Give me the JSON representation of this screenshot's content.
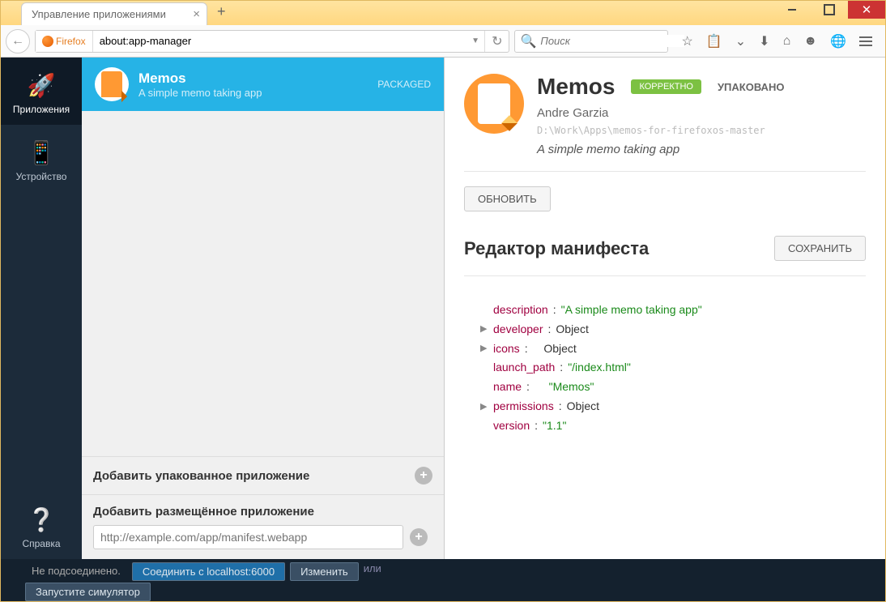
{
  "tab": {
    "title": "Управление приложениями"
  },
  "url": {
    "protocol": "Firefox",
    "value": "about:app-manager"
  },
  "search": {
    "placeholder": "Поиск"
  },
  "nav": {
    "apps": "Приложения",
    "device": "Устройство",
    "help": "Справка"
  },
  "list": {
    "app": {
      "name": "Memos",
      "desc": "A simple memo taking app",
      "type": "PACKAGED"
    },
    "add_packaged": "Добавить упакованное приложение",
    "add_hosted": "Добавить размещённое приложение",
    "hosted_placeholder": "http://example.com/app/manifest.webapp"
  },
  "detail": {
    "title": "Memos",
    "badge": "КОРРЕКТНО",
    "packaged": "УПАКОВАНО",
    "author": "Andre Garzia",
    "path": "D:\\Work\\Apps\\memos-for-firefoxos-master",
    "desc": "A simple memo taking app",
    "update": "ОБНОВИТЬ",
    "manifest_title": "Редактор манифеста",
    "save": "СОХРАНИТЬ"
  },
  "manifest": {
    "description_k": "description",
    "description_v": "\"A simple memo taking app\"",
    "developer_k": "developer",
    "developer_v": "Object",
    "icons_k": "icons",
    "icons_v": "Object",
    "launch_k": "launch_path",
    "launch_v": "\"/index.html\"",
    "name_k": "name",
    "name_v": "\"Memos\"",
    "perms_k": "permissions",
    "perms_v": "Object",
    "version_k": "version",
    "version_v": "\"1.1\""
  },
  "bottom": {
    "status": "Не подсоединено.",
    "connect": "Соединить с localhost:6000",
    "change": "Изменить",
    "or": "или",
    "sim": "Запустите симулятор"
  }
}
